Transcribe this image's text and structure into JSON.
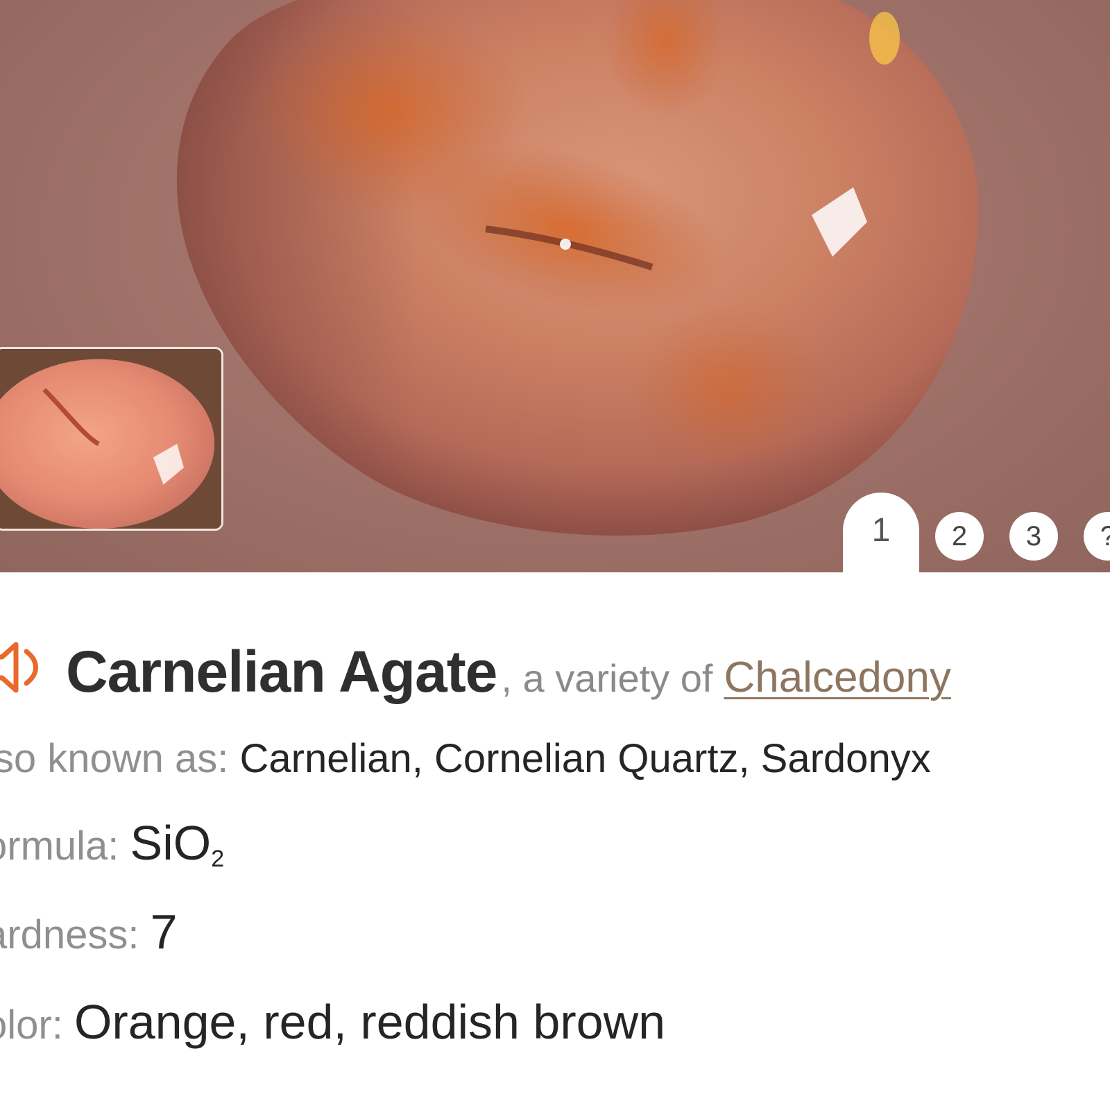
{
  "hero": {
    "image": "carnelian-agate-photo",
    "thumbnail": "carnelian-agate-thumbnail",
    "pager": {
      "active": "1",
      "pages": [
        "2",
        "3",
        "?"
      ]
    }
  },
  "mineral": {
    "name": "Carnelian Agate",
    "variety_text": ", a variety of",
    "parent": "Chalcedony",
    "speaker_icon": "speaker-icon"
  },
  "properties": {
    "aka_label": "lso known as:",
    "aka_value": "Carnelian, Cornelian Quartz, Sardonyx",
    "formula_label": "ormula:",
    "formula_main": "SiO",
    "formula_sub": "2",
    "hardness_label": "ardness:",
    "hardness_value": "7",
    "color_label": "olor:",
    "color_value": "Orange, red, reddish brown"
  },
  "colors": {
    "accent": "#e8692d",
    "link": "#8d7560"
  }
}
